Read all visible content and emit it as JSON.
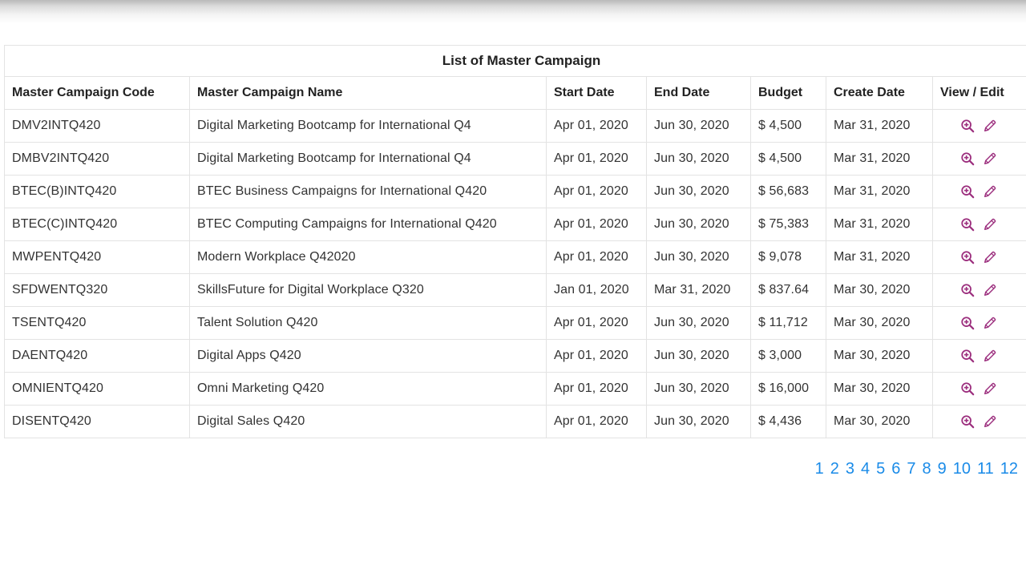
{
  "table": {
    "caption": "List of Master Campaign",
    "headers": {
      "code": "Master Campaign Code",
      "name": "Master Campaign Name",
      "start": "Start Date",
      "end": "End Date",
      "budget": "Budget",
      "created": "Create Date",
      "actions": "View / Edit"
    },
    "rows": [
      {
        "code": "DMV2INTQ420",
        "name": "Digital Marketing Bootcamp for International Q4",
        "start": "Apr 01, 2020",
        "end": "Jun 30, 2020",
        "budget": "$ 4,500",
        "created": "Mar 31, 2020"
      },
      {
        "code": "DMBV2INTQ420",
        "name": "Digital Marketing Bootcamp for International Q4",
        "start": "Apr 01, 2020",
        "end": "Jun 30, 2020",
        "budget": "$ 4,500",
        "created": "Mar 31, 2020"
      },
      {
        "code": "BTEC(B)INTQ420",
        "name": "BTEC Business Campaigns for International Q420",
        "start": "Apr 01, 2020",
        "end": "Jun 30, 2020",
        "budget": "$ 56,683",
        "created": "Mar 31, 2020"
      },
      {
        "code": "BTEC(C)INTQ420",
        "name": "BTEC Computing Campaigns for International Q420",
        "start": "Apr 01, 2020",
        "end": "Jun 30, 2020",
        "budget": "$ 75,383",
        "created": "Mar 31, 2020"
      },
      {
        "code": "MWPENTQ420",
        "name": "Modern Workplace Q42020",
        "start": "Apr 01, 2020",
        "end": "Jun 30, 2020",
        "budget": "$ 9,078",
        "created": "Mar 31, 2020"
      },
      {
        "code": "SFDWENTQ320",
        "name": "SkillsFuture for Digital Workplace Q320",
        "start": "Jan 01, 2020",
        "end": "Mar 31, 2020",
        "budget": "$ 837.64",
        "created": "Mar 30, 2020"
      },
      {
        "code": "TSENTQ420",
        "name": "Talent Solution Q420",
        "start": "Apr 01, 2020",
        "end": "Jun 30, 2020",
        "budget": "$ 11,712",
        "created": "Mar 30, 2020"
      },
      {
        "code": "DAENTQ420",
        "name": "Digital Apps Q420",
        "start": "Apr 01, 2020",
        "end": "Jun 30, 2020",
        "budget": "$ 3,000",
        "created": "Mar 30, 2020"
      },
      {
        "code": "OMNIENTQ420",
        "name": "Omni Marketing Q420",
        "start": "Apr 01, 2020",
        "end": "Jun 30, 2020",
        "budget": "$ 16,000",
        "created": "Mar 30, 2020"
      },
      {
        "code": "DISENTQ420",
        "name": "Digital Sales Q420",
        "start": "Apr 01, 2020",
        "end": "Jun 30, 2020",
        "budget": "$ 4,436",
        "created": "Mar 30, 2020"
      }
    ],
    "row_icons": {
      "view": "zoom-in-icon",
      "edit": "pencil-icon"
    }
  },
  "pagination": {
    "pages": [
      "1",
      "2",
      "3",
      "4",
      "5",
      "6",
      "7",
      "8",
      "9",
      "10",
      "11",
      "12"
    ]
  },
  "colors": {
    "icon": "#9c2f7e",
    "link": "#1a8be8",
    "border": "#e3e3e3"
  }
}
